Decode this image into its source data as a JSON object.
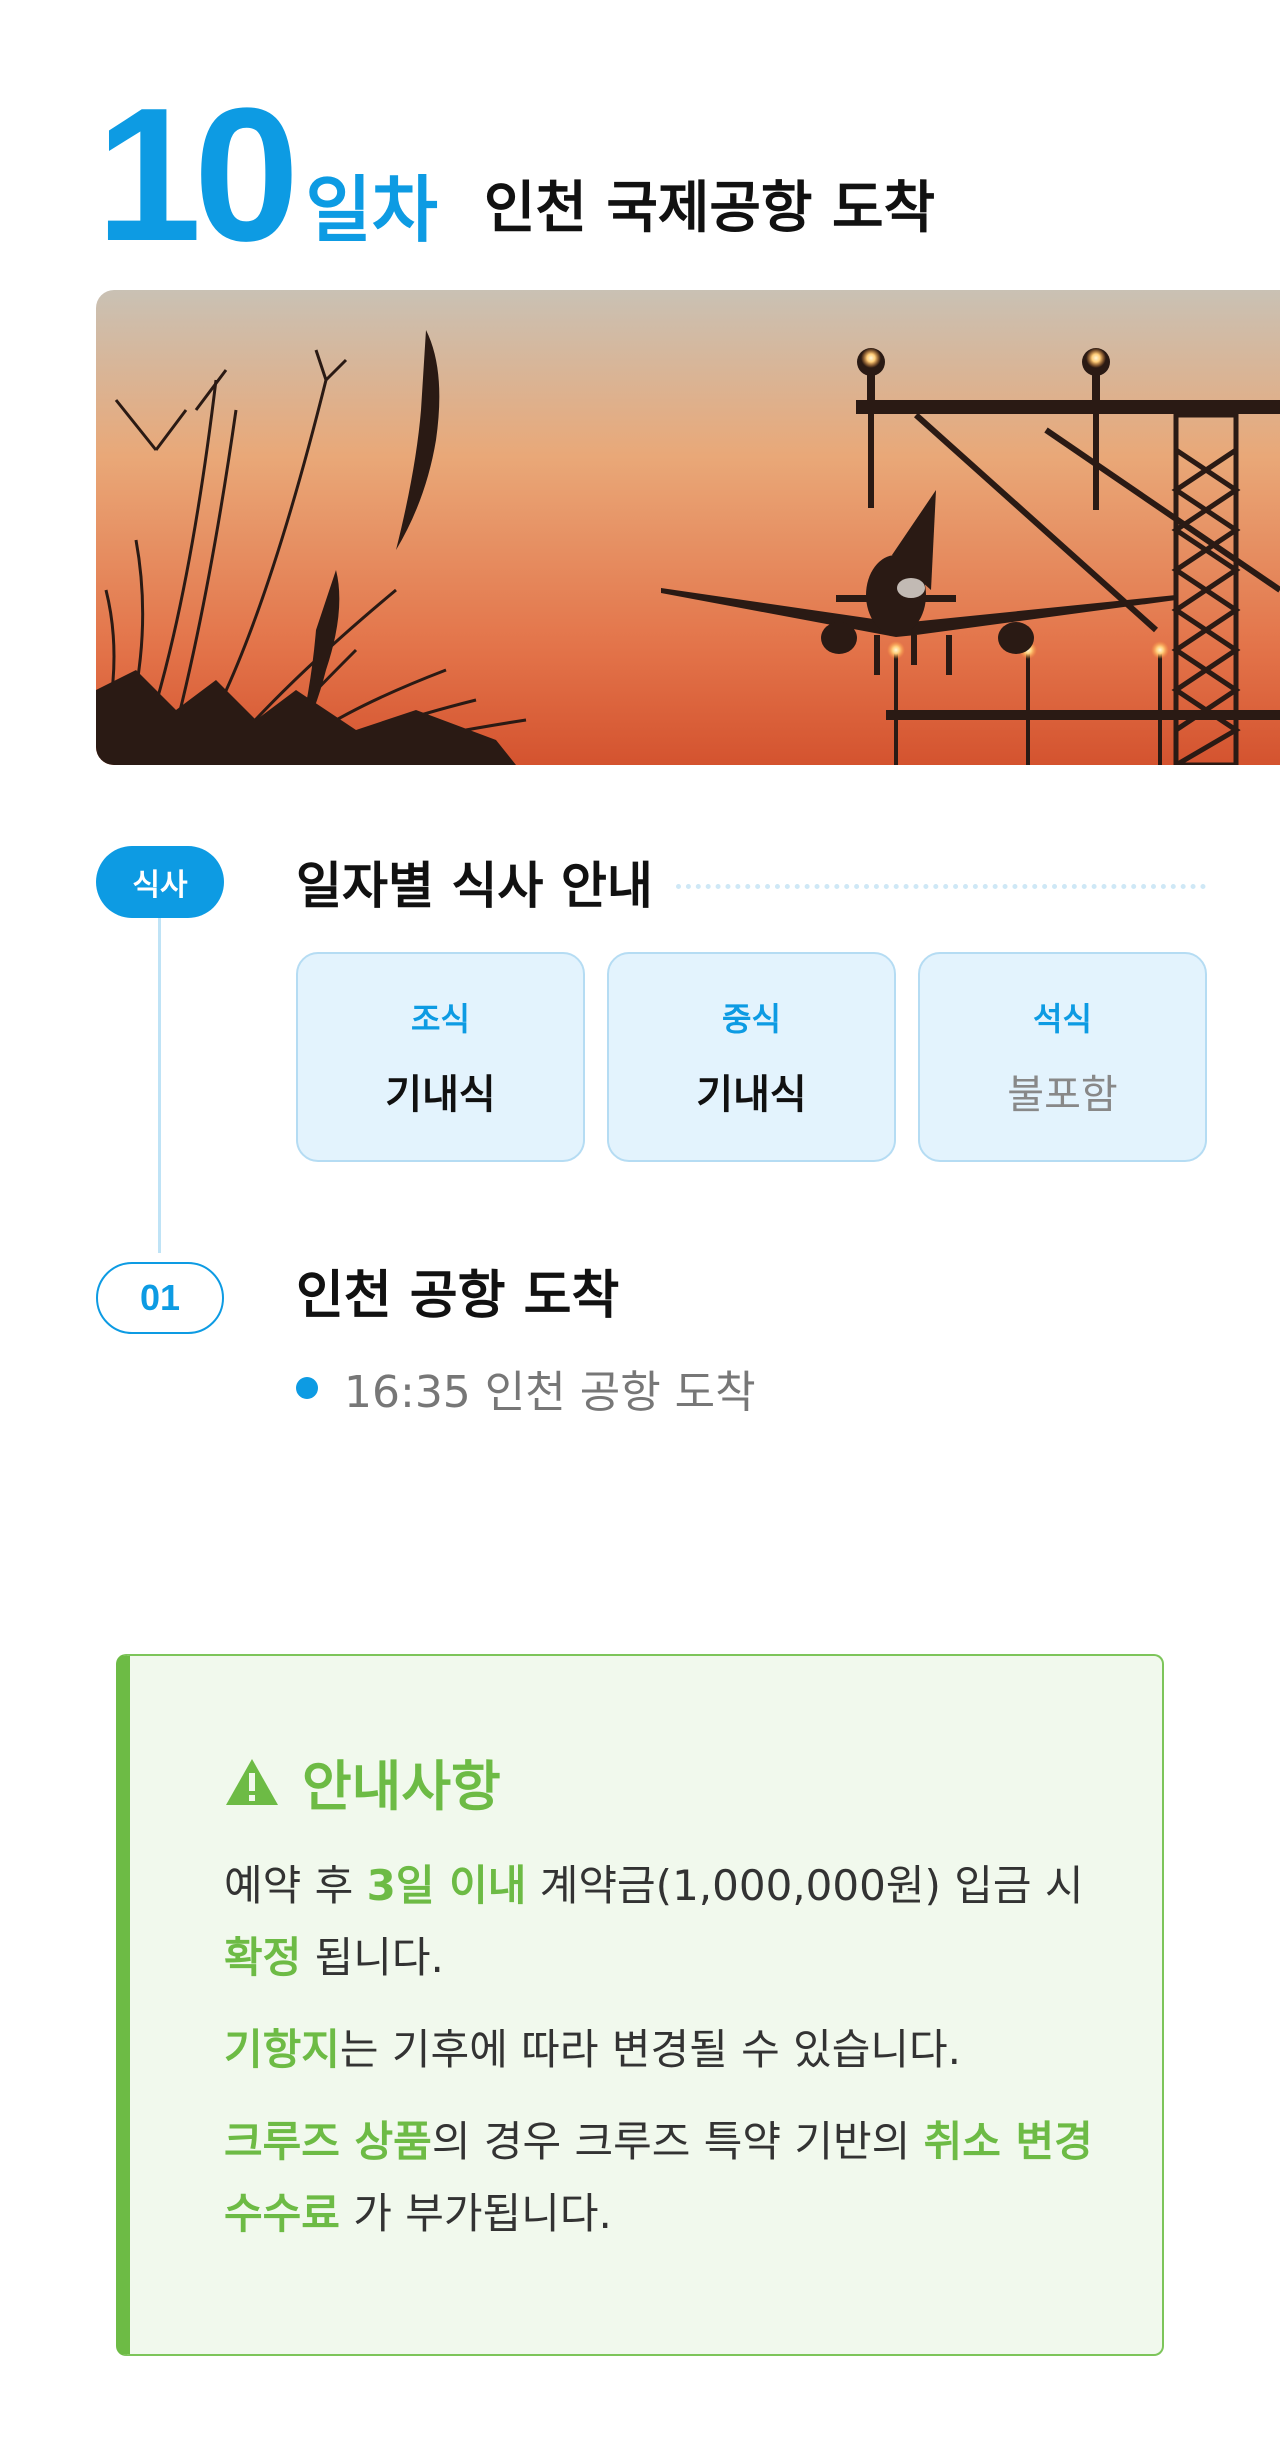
{
  "day": {
    "number": "10",
    "unit": "일차",
    "title": "인천 국제공항 도착"
  },
  "hero_image": {
    "subject": "airplane-landing-at-sunset",
    "colors": {
      "sky_top": "#c9c1b4",
      "sky_mid": "#e69a6b",
      "sky_bottom": "#de5a33",
      "silhouette": "#2a1a14"
    }
  },
  "meals": {
    "badge": "식사",
    "heading": "일자별 식사 안내",
    "cards": [
      {
        "kind": "조식",
        "value": "기내식"
      },
      {
        "kind": "중식",
        "value": "기내식"
      },
      {
        "kind": "석식",
        "value": "불포함"
      }
    ]
  },
  "schedule": {
    "step_number": "01",
    "title": "인천 공항 도착",
    "items": [
      "16:35 인천 공항 도착"
    ]
  },
  "notice": {
    "title": "안내사항",
    "icon": "warning-icon",
    "p1": {
      "a": "예약 후 ",
      "b": "3일 이내",
      "c": " 계약금(1,000,000원) 입금 시 ",
      "d": "확정",
      "e": " 됩니다."
    },
    "p2": {
      "a": "기항지",
      "b": "는 기후에 따라 변경될 수 있습니다."
    },
    "p3": {
      "a": "크루즈 상품",
      "b": "의 경우 크루즈 특약 기반의 ",
      "c": "취소 변경 수수료",
      "d": " 가 부가됩니다."
    }
  },
  "colors": {
    "accent": "#0d9be3",
    "notice_green": "#6dbb45",
    "notice_bg": "#f1f9ed"
  }
}
